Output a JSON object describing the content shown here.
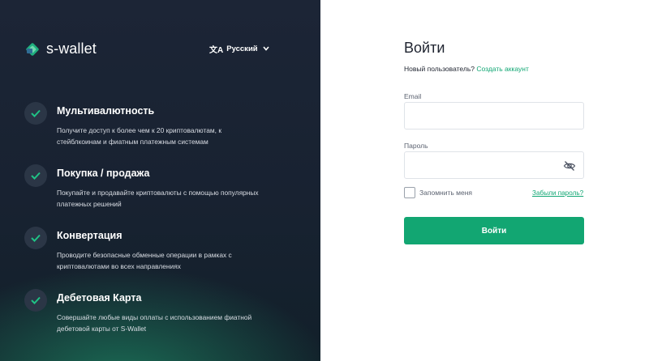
{
  "brand": {
    "name": "s-wallet"
  },
  "language": {
    "icon": "translate-icon",
    "label": "Русский"
  },
  "features": [
    {
      "title": "Мультивалютность",
      "description": "Получите доступ к более чем к 20 криптовалютам, к стейблкоинам и фиатным платежным системам"
    },
    {
      "title": "Покупка / продажа",
      "description": "Покупайте и продавайте криптовалюты с помощью популярных платежных решений"
    },
    {
      "title": "Конвертация",
      "description": "Проводите безопасные обменные операции в рамках с криптовалютами во всех направлениях"
    },
    {
      "title": "Дебетовая Карта",
      "description": "Совершайте любые виды оплаты с использованием фиатной дебетовой карты от S-Wallet"
    }
  ],
  "login": {
    "heading": "Войти",
    "new_user_text": "Новый пользователь?",
    "create_account_link": "Создать аккаунт",
    "email_label": "Email",
    "email_value": "",
    "password_label": "Пароль",
    "password_value": "",
    "remember_label": "Запомнить меня",
    "forgot_link": "Забыли пароль?",
    "submit_label": "Войти"
  },
  "colors": {
    "accent": "#12a672",
    "left_bg": "#1c2536"
  }
}
